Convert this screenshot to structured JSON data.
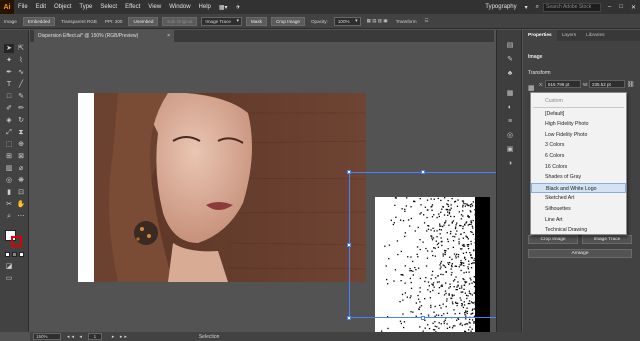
{
  "app": {
    "logo": "Ai"
  },
  "menubar": {
    "items": [
      "File",
      "Edit",
      "Object",
      "Type",
      "Select",
      "Effect",
      "View",
      "Window",
      "Help"
    ],
    "workspace": "Typography",
    "search_placeholder": "Search Adobe Stock"
  },
  "optionsbar": {
    "label": "Image",
    "embedded": "Embedded",
    "color_info": "Transparent RGB",
    "ppi": "PPI: 300",
    "unembed": "Unembed",
    "edit_original": "Edit Original",
    "image_trace": "Image Trace",
    "mask": "Mask",
    "crop_image": "Crop Image",
    "opacity_label": "Opacity:",
    "opacity_value": "100%",
    "transform": "Transform"
  },
  "document": {
    "tab_title": "Dispersion Effect.ai* @ 150% (RGB/Preview)",
    "close": "×"
  },
  "statusbar": {
    "zoom": "150%",
    "nav": "◂◂ ◂",
    "page": "1",
    "nav_next": "▸ ▸▸",
    "status": "Selection"
  },
  "panel": {
    "tabs": [
      "Properties",
      "Layers",
      "Libraries"
    ],
    "section_image": "Image",
    "section_transform": "Transform",
    "x_label": "X:",
    "x_value": "616.798 pt",
    "w_label": "W:",
    "w_value": "235.52 pt",
    "crop_image": "Crop Image",
    "image_trace": "Image Trace",
    "arrange": "Arrange"
  },
  "trace_presets": {
    "items": [
      "Custom",
      "[Default]",
      "High Fidelity Photo",
      "Low Fidelity Photo",
      "3 Colors",
      "6 Colors",
      "16 Colors",
      "Shades of Gray",
      "Black and White Logo",
      "Sketched Art",
      "Silhouettes",
      "Line Art",
      "Technical Drawing"
    ],
    "highlighted": "Black and White Logo"
  },
  "colors": {
    "accent_selection": "#4a7fff",
    "logo_bg": "#261300",
    "logo_fg": "#ff9a00",
    "highlight": "#d4e2f2"
  }
}
